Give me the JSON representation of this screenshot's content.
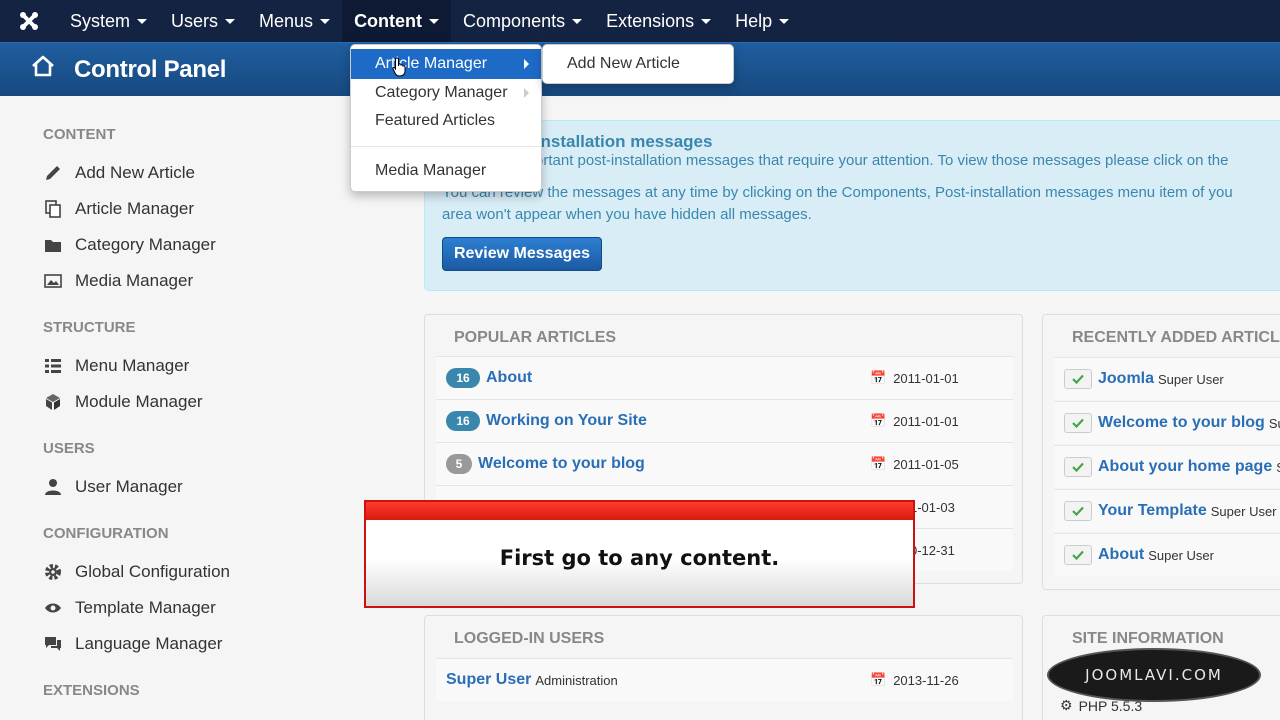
{
  "topnav": {
    "items": [
      {
        "label": "System"
      },
      {
        "label": "Users"
      },
      {
        "label": "Menus"
      },
      {
        "label": "Content"
      },
      {
        "label": "Components"
      },
      {
        "label": "Extensions"
      },
      {
        "label": "Help"
      }
    ]
  },
  "header": {
    "title": "Control Panel"
  },
  "dropdown": {
    "items": [
      "Article Manager",
      "Category Manager",
      "Featured Articles",
      "Media Manager"
    ],
    "submenu": [
      "Add New Article"
    ]
  },
  "sidebar": {
    "sections": [
      "CONTENT",
      "STRUCTURE",
      "USERS",
      "CONFIGURATION",
      "EXTENSIONS"
    ],
    "links": [
      {
        "label": "Add New Article",
        "icon": "pencil-icon"
      },
      {
        "label": "Article Manager",
        "icon": "copy-icon"
      },
      {
        "label": "Category Manager",
        "icon": "folder-icon"
      },
      {
        "label": "Media Manager",
        "icon": "image-icon"
      },
      {
        "label": "Menu Manager",
        "icon": "list-icon"
      },
      {
        "label": "Module Manager",
        "icon": "cube-icon"
      },
      {
        "label": "User Manager",
        "icon": "user-icon"
      },
      {
        "label": "Global Configuration",
        "icon": "gear-icon"
      },
      {
        "label": "Template Manager",
        "icon": "eye-icon"
      },
      {
        "label": "Language Manager",
        "icon": "comments-icon"
      }
    ]
  },
  "message": {
    "title": "st-installation messages",
    "line1": "ortant post-installation messages that require your attention. To view those messages please click on the",
    "line2": "You can review the messages at any time by clicking on the Components, Post-installation messages menu item of you",
    "line3": "area won't appear when you have hidden all messages.",
    "button": "Review Messages"
  },
  "popular": {
    "title": "POPULAR ARTICLES",
    "rows": [
      {
        "hits": "16",
        "title": "About",
        "date": "2011-01-01"
      },
      {
        "hits": "16",
        "title": "Working on Your Site",
        "date": "2011-01-01"
      },
      {
        "hits": "5",
        "title": "Welcome to your blog",
        "date": "2011-01-05"
      },
      {
        "date": "1-01-03"
      },
      {
        "date": "0-12-31"
      }
    ]
  },
  "recent": {
    "title": "RECENTLY ADDED ARTICLE",
    "rows": [
      {
        "title": "Joomla",
        "author": "Super User"
      },
      {
        "title": "Welcome to your blog",
        "author": "Su"
      },
      {
        "title": "About your home page",
        "author": "S"
      },
      {
        "title": "Your Template",
        "author": "Super User"
      },
      {
        "title": "About",
        "author": "Super User"
      }
    ]
  },
  "logged": {
    "title": "LOGGED-IN USERS",
    "rows": [
      {
        "name": "Super User",
        "role": "Administration",
        "date": "2013-11-26"
      }
    ]
  },
  "siteinfo": {
    "title": "SITE INFORMATION",
    "php": "PHP 5.5.3"
  },
  "caption": {
    "text": "First go to any content."
  },
  "watermark": {
    "text": "JOOMLAVI.COM"
  },
  "colors": {
    "nav": "#152342",
    "header": "#1f5ea0",
    "accent": "#1d6bc7",
    "link": "#2a6fb6",
    "alert": "#d9edf7",
    "caption_bar": "#e0261a"
  }
}
